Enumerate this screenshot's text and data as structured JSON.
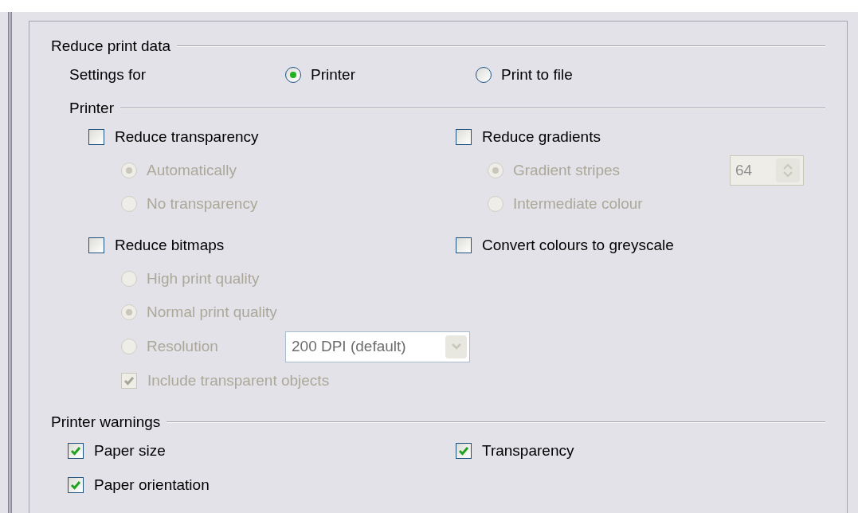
{
  "reduce_print_data": {
    "title": "Reduce print data",
    "settings_for": {
      "label": "Settings for",
      "options": [
        {
          "label": "Printer",
          "selected": true
        },
        {
          "label": "Print to file",
          "selected": false
        }
      ]
    },
    "printer": {
      "title": "Printer",
      "reduce_transparency": {
        "label": "Reduce transparency",
        "checked": false,
        "options": [
          {
            "label": "Automatically",
            "selected": true,
            "disabled": true
          },
          {
            "label": "No transparency",
            "selected": false,
            "disabled": true
          }
        ]
      },
      "reduce_gradients": {
        "label": "Reduce gradients",
        "checked": false,
        "options": [
          {
            "label": "Gradient stripes",
            "selected": true,
            "disabled": true
          },
          {
            "label": "Intermediate colour",
            "selected": false,
            "disabled": true
          }
        ],
        "stripes": {
          "value": "64",
          "disabled": true
        }
      },
      "reduce_bitmaps": {
        "label": "Reduce bitmaps",
        "checked": false,
        "options": [
          {
            "label": "High print quality",
            "selected": false,
            "disabled": true
          },
          {
            "label": "Normal print quality",
            "selected": true,
            "disabled": true
          },
          {
            "label": "Resolution",
            "selected": false,
            "disabled": true
          }
        ],
        "resolution": {
          "value": "200 DPI (default)",
          "disabled": true
        },
        "include_transparent": {
          "label": "Include transparent objects",
          "checked": true,
          "disabled": true
        }
      },
      "convert_greyscale": {
        "label": "Convert colours to greyscale",
        "checked": false
      }
    }
  },
  "printer_warnings": {
    "title": "Printer warnings",
    "items": [
      {
        "label": "Paper size",
        "checked": true
      },
      {
        "label": "Transparency",
        "checked": true
      },
      {
        "label": "Paper orientation",
        "checked": true
      }
    ]
  }
}
